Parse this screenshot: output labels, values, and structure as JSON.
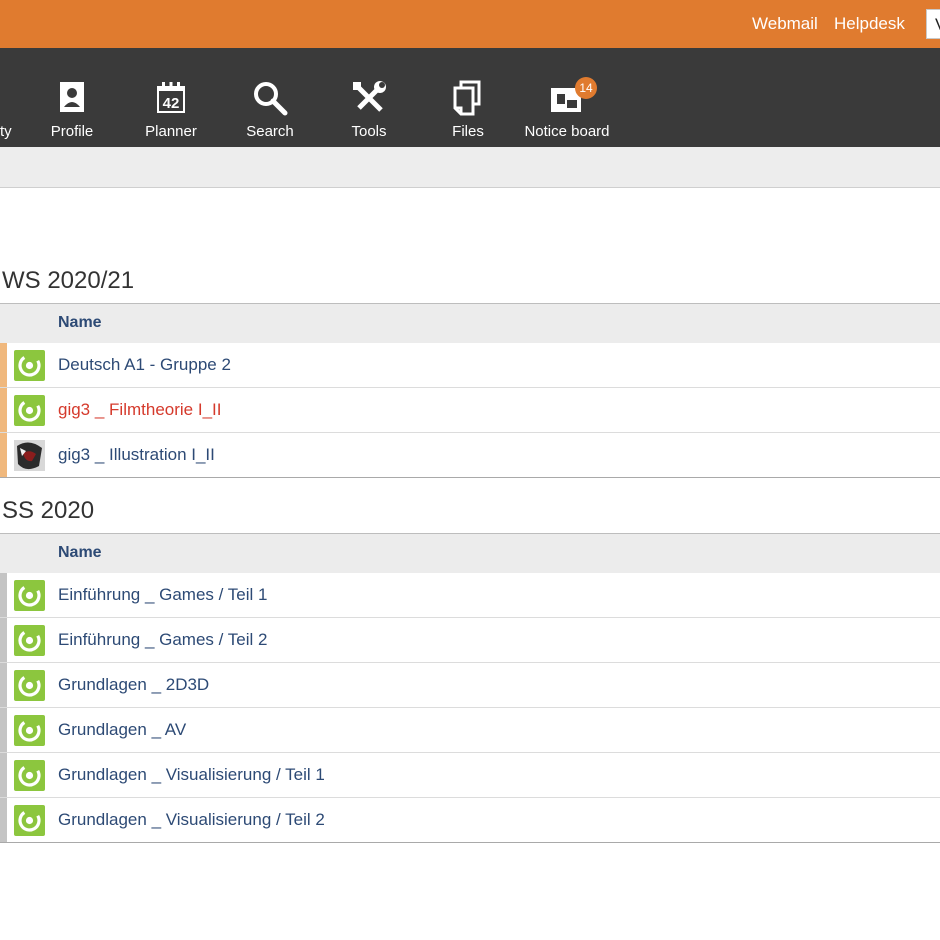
{
  "header": {
    "links": {
      "webmail": "Webmail",
      "helpdesk": "Helpdesk"
    },
    "search_value": "V"
  },
  "nav": {
    "partial_label": "ty",
    "items": [
      {
        "label": "Profile",
        "icon": "profile-icon"
      },
      {
        "label": "Planner",
        "icon": "planner-icon",
        "day": "42"
      },
      {
        "label": "Search",
        "icon": "search-icon"
      },
      {
        "label": "Tools",
        "icon": "tools-icon"
      },
      {
        "label": "Files",
        "icon": "files-icon"
      },
      {
        "label": "Notice board",
        "icon": "notice-board-icon",
        "badge": "14"
      }
    ]
  },
  "sections": [
    {
      "title": "WS 2020/21",
      "column_header": "Name",
      "rows": [
        {
          "name": "Deutsch A1 - Gruppe 2",
          "icon": "course-icon"
        },
        {
          "name": "gig3 _ Filmtheorie I_II",
          "icon": "course-icon",
          "highlight": true
        },
        {
          "name": "gig3 _ Illustration I_II",
          "icon": "course-thumbnail"
        }
      ]
    },
    {
      "title": "SS 2020",
      "column_header": "Name",
      "rows": [
        {
          "name": "Einführung _ Games / Teil 1",
          "icon": "course-icon"
        },
        {
          "name": "Einführung _ Games / Teil 2",
          "icon": "course-icon"
        },
        {
          "name": "Grundlagen _ 2D3D",
          "icon": "course-icon"
        },
        {
          "name": "Grundlagen _ AV",
          "icon": "course-icon"
        },
        {
          "name": "Grundlagen _ Visualisierung / Teil 1",
          "icon": "course-icon"
        },
        {
          "name": "Grundlagen _ Visualisierung / Teil 2",
          "icon": "course-icon"
        }
      ]
    }
  ],
  "colors": {
    "accent": "#e07b2f",
    "nav_bg": "#3a3a3a",
    "link": "#2d4a75",
    "highlight": "#d53a2c",
    "course_icon": "#8cc63e"
  }
}
